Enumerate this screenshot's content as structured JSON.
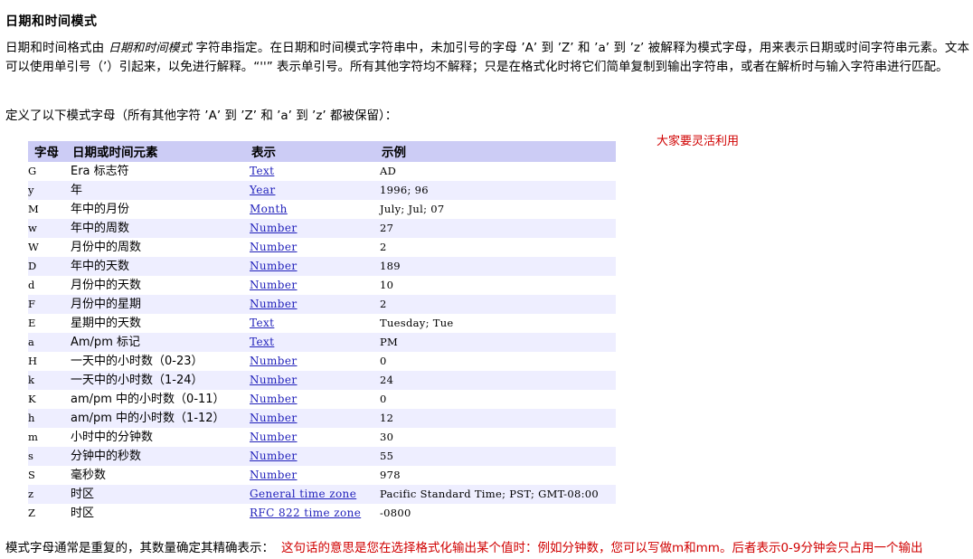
{
  "document": {
    "title": "日期和时间模式",
    "paragraphs": {
      "p1_part1": "日期和时间格式由 ",
      "p1_italic": "日期和时间模式",
      "p1_part2": " 字符串指定。在日期和时间模式字符串中，未加引号的字母 ’A’ 到 ’Z’ 和 ’a’ 到 ’z’ 被解释为模式字母，用来表示日期或时间字符串元素。文本可以使用单引号（’）引起来，以免进行解释。“''” 表示单引号。所有其他字符均不解释；只是在格式化时将它们简单复制到输出字符串，或者在解析时与输入字符串进行匹配。",
      "p2": "定义了以下模式字母（所有其他字符 ’A’ 到 ’Z’ 和 ’a’ 到 ’z’ 都被保留）："
    },
    "annotations": {
      "top_right_red": "大家要灵活利用",
      "bottom_black": "模式字母通常是重复的，其数量确定其精确表示：",
      "bottom_red": "这句话的意思是您在选择格式化输出某个值时：例如分钟数，您可以写做m和mm。后者表示0-9分钟会只占用一个输出"
    }
  },
  "table": {
    "headers": {
      "letter": "字母",
      "element": "日期或时间元素",
      "presentation": "表示",
      "example": "示例"
    },
    "rows": [
      {
        "letter": "G",
        "element": "Era 标志符",
        "presentation": "Text",
        "example": "AD"
      },
      {
        "letter": "y",
        "element": "年",
        "presentation": "Year",
        "example": "1996; 96"
      },
      {
        "letter": "M",
        "element": "年中的月份",
        "presentation": "Month",
        "example": "July; Jul; 07"
      },
      {
        "letter": "w",
        "element": "年中的周数",
        "presentation": "Number",
        "example": "27"
      },
      {
        "letter": "W",
        "element": "月份中的周数",
        "presentation": "Number",
        "example": "2"
      },
      {
        "letter": "D",
        "element": "年中的天数",
        "presentation": "Number",
        "example": "189"
      },
      {
        "letter": "d",
        "element": "月份中的天数",
        "presentation": "Number",
        "example": "10"
      },
      {
        "letter": "F",
        "element": "月份中的星期",
        "presentation": "Number",
        "example": "2"
      },
      {
        "letter": "E",
        "element": "星期中的天数",
        "presentation": "Text",
        "example": "Tuesday; Tue"
      },
      {
        "letter": "a",
        "element": "Am/pm 标记",
        "presentation": "Text",
        "example": "PM"
      },
      {
        "letter": "H",
        "element": "一天中的小时数（0-23）",
        "presentation": "Number",
        "example": "0"
      },
      {
        "letter": "k",
        "element": "一天中的小时数（1-24）",
        "presentation": "Number",
        "example": "24"
      },
      {
        "letter": "K",
        "element": "am/pm 中的小时数（0-11）",
        "presentation": "Number",
        "example": "0"
      },
      {
        "letter": "h",
        "element": "am/pm 中的小时数（1-12）",
        "presentation": "Number",
        "example": "12"
      },
      {
        "letter": "m",
        "element": "小时中的分钟数",
        "presentation": "Number",
        "example": "30"
      },
      {
        "letter": "s",
        "element": "分钟中的秒数",
        "presentation": "Number",
        "example": "55"
      },
      {
        "letter": "S",
        "element": "毫秒数",
        "presentation": "Number",
        "example": "978"
      },
      {
        "letter": "z",
        "element": "时区",
        "presentation": "General time zone",
        "example": "Pacific Standard Time; PST; GMT-08:00"
      },
      {
        "letter": "Z",
        "element": "时区",
        "presentation": "RFC 822 time zone",
        "example": "-0800"
      }
    ]
  },
  "colors": {
    "header_bg": "#ccccf5",
    "alt_row_bg": "#eeeeff",
    "link": "#2222bb",
    "annotation_red": "#d00000"
  }
}
